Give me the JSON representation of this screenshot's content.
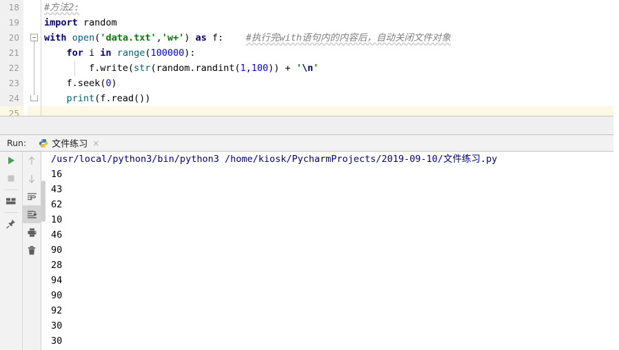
{
  "editor": {
    "lines": [
      {
        "num": "18",
        "fold": "none",
        "indent_guides": [],
        "tokens": [
          {
            "t": "#方法2:",
            "c": "cmt squiggle"
          }
        ]
      },
      {
        "num": "19",
        "fold": "none",
        "indent_guides": [],
        "tokens": [
          {
            "t": "import",
            "c": "kw"
          },
          {
            "t": " random",
            "c": "plain"
          }
        ]
      },
      {
        "num": "20",
        "fold": "start",
        "indent_guides": [],
        "tokens": [
          {
            "t": "with",
            "c": "kw"
          },
          {
            "t": " ",
            "c": "plain"
          },
          {
            "t": "open",
            "c": "bluefn"
          },
          {
            "t": "(",
            "c": "plain"
          },
          {
            "t": "'data.txt'",
            "c": "str"
          },
          {
            "t": ",",
            "c": "plain"
          },
          {
            "t": "'w+'",
            "c": "str"
          },
          {
            "t": ")",
            "c": "plain"
          },
          {
            "t": " ",
            "c": "plain"
          },
          {
            "t": "as",
            "c": "kw"
          },
          {
            "t": " f:",
            "c": "plain"
          },
          {
            "t": "    ",
            "c": "plain"
          },
          {
            "t": "#执行完with语句内的内容后，自动关闭文件对象",
            "c": "cmt squiggle"
          }
        ]
      },
      {
        "num": "21",
        "fold": "line",
        "indent_guides": [],
        "tokens": [
          {
            "t": "    ",
            "c": "plain"
          },
          {
            "t": "for",
            "c": "kw"
          },
          {
            "t": " i ",
            "c": "plain"
          },
          {
            "t": "in",
            "c": "kw"
          },
          {
            "t": " ",
            "c": "plain"
          },
          {
            "t": "range",
            "c": "bluefn"
          },
          {
            "t": "(",
            "c": "plain"
          },
          {
            "t": "100000",
            "c": "num"
          },
          {
            "t": "):",
            "c": "plain"
          }
        ]
      },
      {
        "num": "22",
        "fold": "line",
        "indent_guides": [
          44
        ],
        "tokens": [
          {
            "t": "        f.write(",
            "c": "plain"
          },
          {
            "t": "str",
            "c": "bluefn"
          },
          {
            "t": "(random.randint(",
            "c": "plain"
          },
          {
            "t": "1",
            "c": "num"
          },
          {
            "t": ",",
            "c": "plain"
          },
          {
            "t": "100",
            "c": "num"
          },
          {
            "t": ")) + ",
            "c": "plain"
          },
          {
            "t": "'",
            "c": "str"
          },
          {
            "t": "\\n",
            "c": "esc"
          },
          {
            "t": "'",
            "c": "str"
          }
        ]
      },
      {
        "num": "23",
        "fold": "line",
        "indent_guides": [],
        "tokens": [
          {
            "t": "    f.seek(",
            "c": "plain"
          },
          {
            "t": "0",
            "c": "num"
          },
          {
            "t": ")",
            "c": "plain"
          }
        ]
      },
      {
        "num": "24",
        "fold": "end",
        "indent_guides": [],
        "tokens": [
          {
            "t": "    ",
            "c": "plain"
          },
          {
            "t": "print",
            "c": "bluefn"
          },
          {
            "t": "(f.read())",
            "c": "plain"
          }
        ]
      },
      {
        "num": "25",
        "fold": "none",
        "current": true,
        "indent_guides": [],
        "tokens": []
      }
    ]
  },
  "run_panel": {
    "label": "Run:",
    "tab_label": "文件练习",
    "tab_icon": "python-icon",
    "close_label": "×",
    "toolbar_left": [
      {
        "name": "run-button",
        "icon": "play-icon"
      },
      {
        "name": "stop-button",
        "icon": "stop-icon"
      },
      {
        "name": "separator",
        "icon": "separator"
      },
      {
        "name": "layout-button",
        "icon": "layout-icon"
      },
      {
        "name": "separator",
        "icon": "separator"
      },
      {
        "name": "pin-tab-button",
        "icon": "pin-icon"
      }
    ],
    "toolbar_right": [
      {
        "name": "up-the-stack-trace-button",
        "icon": "arrow-up-icon",
        "active": false
      },
      {
        "name": "down-the-stack-trace-button",
        "icon": "arrow-down-icon",
        "active": false
      },
      {
        "name": "soft-wrap-button",
        "icon": "soft-wrap-icon",
        "active": false
      },
      {
        "name": "scroll-to-end-button",
        "icon": "scroll-to-end-icon",
        "active": true
      },
      {
        "name": "print-button",
        "icon": "printer-icon",
        "active": false
      },
      {
        "name": "clear-all-button",
        "icon": "trash-icon",
        "active": false
      }
    ]
  },
  "console": {
    "command": "/usr/local/python3/bin/python3 /home/kiosk/PycharmProjects/2019-09-10/文件练习.py",
    "output": [
      "16",
      "43",
      "62",
      "10",
      "46",
      "90",
      "28",
      "94",
      "90",
      "92",
      "30",
      "30"
    ]
  },
  "colors": {
    "keyword": "#000080",
    "string": "#008000",
    "number": "#0000ff",
    "comment": "#808080",
    "builtin": "#00627a",
    "current_line": "#fdf8e4",
    "console_command": "#000080",
    "run_icon_green": "#499c54",
    "panel_bg": "#f2f2f2"
  }
}
